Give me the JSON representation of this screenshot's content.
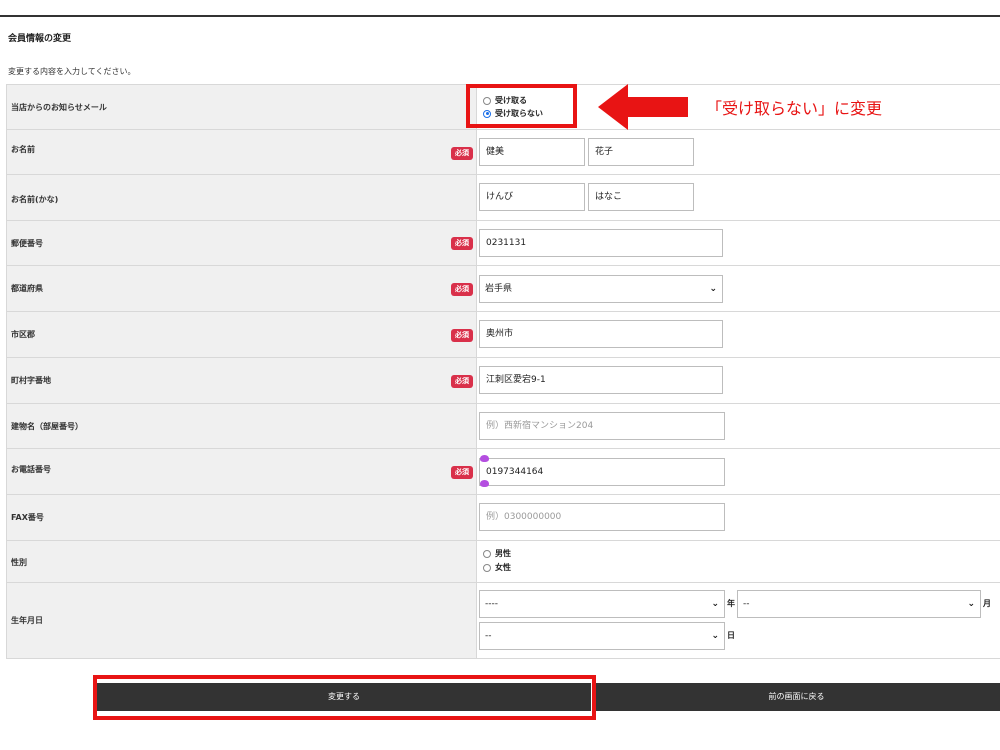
{
  "page": {
    "heading": "会員情報の変更",
    "intro": "変更する内容を入力してください。"
  },
  "required_badge": "必須",
  "rows": {
    "newsletter": {
      "label": "当店からのお知らせメール",
      "options": [
        "受け取る",
        "受け取らない"
      ],
      "selected": "受け取らない"
    },
    "name": {
      "label": "お名前",
      "last": "健美",
      "first": "花子"
    },
    "name_kana": {
      "label": "お名前(かな)",
      "last": "けんび",
      "first": "はなこ"
    },
    "postal": {
      "label": "郵便番号",
      "value": "0231131"
    },
    "prefecture": {
      "label": "都道府県",
      "value": "岩手県"
    },
    "city": {
      "label": "市区郡",
      "value": "奥州市"
    },
    "town": {
      "label": "町村字番地",
      "value": "江刺区愛宕9-1"
    },
    "building": {
      "label": "建物名（部屋番号）",
      "placeholder": "例）西新宿マンション204"
    },
    "phone": {
      "label": "お電話番号",
      "value": "0197344164"
    },
    "fax": {
      "label": "FAX番号",
      "placeholder": "例）0300000000"
    },
    "gender": {
      "label": "性別",
      "options": [
        "男性",
        "女性"
      ]
    },
    "birthdate": {
      "label": "生年月日",
      "year_value": "----",
      "year_unit": "年",
      "month_value": "--",
      "month_unit": "月",
      "day_value": "--",
      "day_unit": "日"
    }
  },
  "buttons": {
    "submit": "変更する",
    "back": "前の画面に戻る"
  },
  "annotation": {
    "text": "「受け取らない」に変更",
    "color": "#e81414"
  },
  "colors": {
    "required_badge": "#d9304a",
    "button_bg": "#333333",
    "label_bg": "#f0f0f0",
    "radio_selected": "#1a6ee8"
  }
}
